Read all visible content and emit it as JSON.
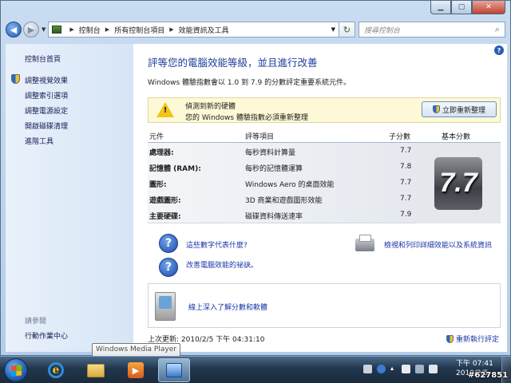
{
  "window": {
    "title": ""
  },
  "nav": {
    "breadcrumb": [
      "控制台",
      "所有控制台項目",
      "效能資訊及工具"
    ],
    "search_placeholder": "搜尋控制台"
  },
  "sidebar": {
    "home": "控制台首頁",
    "links": [
      "調整視覺效果",
      "調整索引選項",
      "調整電源設定",
      "開啟磁碟清理",
      "進階工具"
    ],
    "see_also_title": "請參閱",
    "see_also_links": [
      "行動作業中心"
    ]
  },
  "main": {
    "title": "評等您的電腦效能等級，並且進行改善",
    "description": "Windows 體驗指數會以 1.0 到 7.9 的分數評定重要系統元件。",
    "notice": {
      "line1": "偵測到新的硬體",
      "line2": "您的 Windows 體驗指數必須重新整理",
      "button": "立即重新整理"
    },
    "table": {
      "headers": {
        "component": "元件",
        "item": "評等項目",
        "subscore": "子分數",
        "base": "基本分數"
      },
      "rows": [
        {
          "component": "處理器:",
          "item": "每秒資料計算量",
          "score": "7.7"
        },
        {
          "component": "記憶體 (RAM):",
          "item": "每秒的記憶體運算",
          "score": "7.8"
        },
        {
          "component": "圖形:",
          "item": "Windows Aero 的桌面效能",
          "score": "7.7"
        },
        {
          "component": "遊戲圖形:",
          "item": "3D 商業和遊戲圖形效能",
          "score": "7.7"
        },
        {
          "component": "主要硬碟:",
          "item": "磁碟資料傳送速率",
          "score": "7.9"
        }
      ],
      "base_score": "7.7"
    },
    "links": {
      "meaning": "這些數字代表什麼?",
      "improve": "改善電腦效能的祕訣。",
      "details": "檢視和列印詳細效能以及系統資訊",
      "learn_more": "線上深入了解分數和軟體"
    },
    "last_update": "上次更新: 2010/2/5 下午 04:31:10",
    "rerun": "重新執行評定"
  },
  "tooltip": "Windows Media Player",
  "taskbar": {
    "clock_time": "下午 07:41",
    "clock_date": "2010/2/5",
    "watermark": "#627851"
  }
}
